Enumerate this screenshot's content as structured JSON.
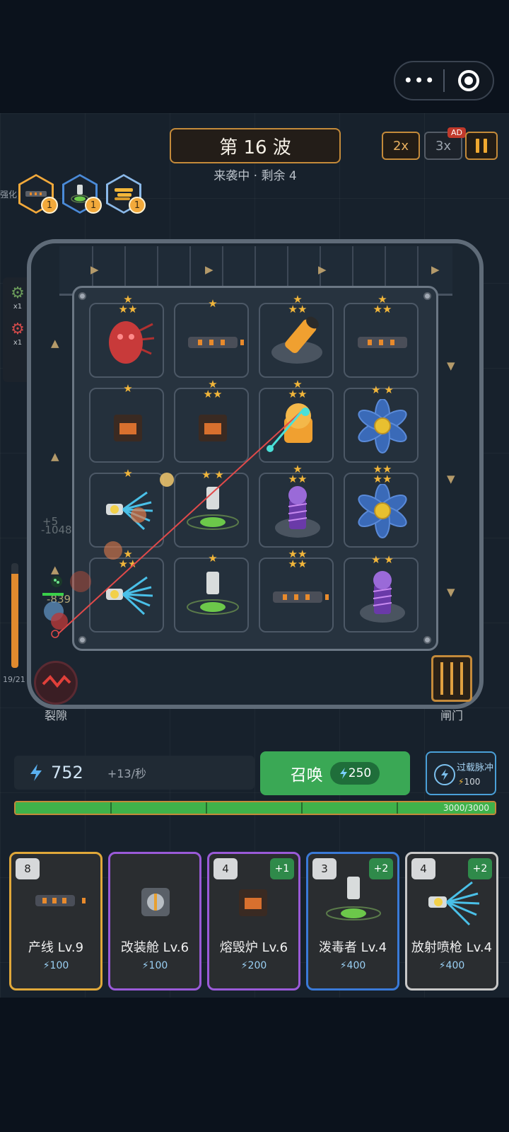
{
  "header": {
    "wave_title": "第 16 波",
    "wave_status": "来袭中 · 剩余 4",
    "speed_2x": "2x",
    "speed_3x": "3x",
    "ad_badge": "AD"
  },
  "upgrades": {
    "side_label": "强化",
    "items": [
      {
        "icon": "production-line-icon",
        "count": "1",
        "color": "#f2a93b"
      },
      {
        "icon": "poisoner-icon",
        "count": "1",
        "color": "#4a8ad8"
      },
      {
        "icon": "bullet-icon",
        "count": "1",
        "color": "#8ab8e8"
      }
    ]
  },
  "side_panel": {
    "items": [
      {
        "icon": "green-gear-icon",
        "count": "x1"
      },
      {
        "icon": "red-gear-icon",
        "count": "x1"
      }
    ]
  },
  "board": {
    "cells": [
      {
        "type": "crab-monster",
        "stars": 3
      },
      {
        "type": "production-line",
        "stars": 1
      },
      {
        "type": "mortar",
        "stars": 3
      },
      {
        "type": "production-line",
        "stars": 3
      },
      {
        "type": "furnace",
        "stars": 1
      },
      {
        "type": "furnace",
        "stars": 3
      },
      {
        "type": "orange-robot",
        "stars": 3
      },
      {
        "type": "blue-flower",
        "stars": 2
      },
      {
        "type": "radiation-gun",
        "stars": 1
      },
      {
        "type": "poisoner",
        "stars": 2
      },
      {
        "type": "tesla-coil",
        "stars": 3
      },
      {
        "type": "blue-flower",
        "stars": 4
      },
      {
        "type": "radiation-gun",
        "stars": 3
      },
      {
        "type": "poisoner",
        "stars": 1
      },
      {
        "type": "production-line",
        "stars": 4
      },
      {
        "type": "tesla-coil",
        "stars": 2
      }
    ],
    "floating_texts": [
      "+5",
      "-1048",
      "-839"
    ]
  },
  "rift": {
    "label": "裂隙",
    "hp_text": "19/21",
    "hp_fraction": 0.9
  },
  "gate": {
    "label": "闸门"
  },
  "economy": {
    "energy": "752",
    "rate": "+13/秒",
    "summon_label": "召唤",
    "summon_cost": "250",
    "overload_label": "过载脉冲",
    "overload_cost": "100"
  },
  "base_hp": {
    "text": "3000/3000",
    "fraction": 1.0
  },
  "cards": [
    {
      "level": "8",
      "plus": "",
      "name": "产线 Lv.9",
      "cost": "100",
      "border": "#e0a83a",
      "icon": "production-line-icon"
    },
    {
      "level": "",
      "plus": "",
      "name": "改装舱 Lv.6",
      "cost": "100",
      "border": "#9a5ad8",
      "icon": "refit-pod-icon"
    },
    {
      "level": "4",
      "plus": "+1",
      "name": "熔毁炉 Lv.6",
      "cost": "200",
      "border": "#9a5ad8",
      "icon": "furnace-icon"
    },
    {
      "level": "3",
      "plus": "+2",
      "name": "泼毒者 Lv.4",
      "cost": "400",
      "border": "#3a7ad8",
      "icon": "poisoner-icon"
    },
    {
      "level": "4",
      "plus": "+2",
      "name": "放射喷枪 Lv.4",
      "cost": "400",
      "border": "#c8c8c8",
      "icon": "radiation-gun-icon"
    }
  ]
}
